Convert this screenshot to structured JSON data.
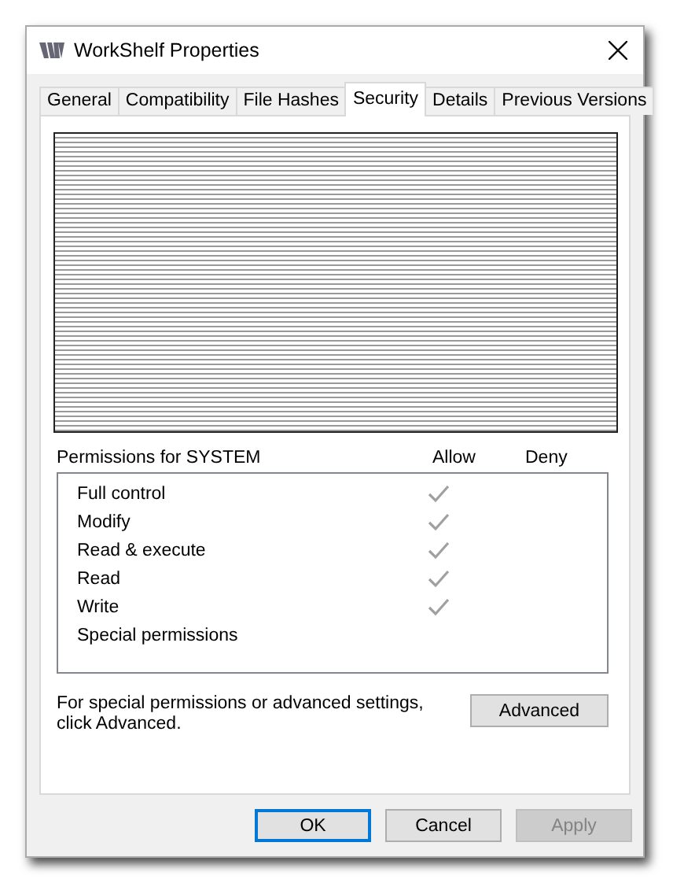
{
  "window": {
    "title": "WorkShelf Properties"
  },
  "tabs": [
    {
      "label": "General",
      "selected": false
    },
    {
      "label": "Compatibility",
      "selected": false
    },
    {
      "label": "File Hashes",
      "selected": false
    },
    {
      "label": "Security",
      "selected": true
    },
    {
      "label": "Details",
      "selected": false
    },
    {
      "label": "Previous Versions",
      "selected": false
    }
  ],
  "permissions": {
    "title": "Permissions for SYSTEM",
    "columns": [
      "Allow",
      "Deny"
    ],
    "rows": [
      {
        "name": "Full control",
        "allow": true,
        "deny": false
      },
      {
        "name": "Modify",
        "allow": true,
        "deny": false
      },
      {
        "name": "Read & execute",
        "allow": true,
        "deny": false
      },
      {
        "name": "Read",
        "allow": true,
        "deny": false
      },
      {
        "name": "Write",
        "allow": true,
        "deny": false
      },
      {
        "name": "Special permissions",
        "allow": false,
        "deny": false
      }
    ]
  },
  "advanced_note": "For special permissions or advanced settings, click Advanced.",
  "advanced_button": "Advanced",
  "buttons": [
    {
      "label": "OK",
      "default": true,
      "disabled": false
    },
    {
      "label": "Cancel",
      "default": false,
      "disabled": false
    },
    {
      "label": "Apply",
      "default": false,
      "disabled": true
    }
  ]
}
